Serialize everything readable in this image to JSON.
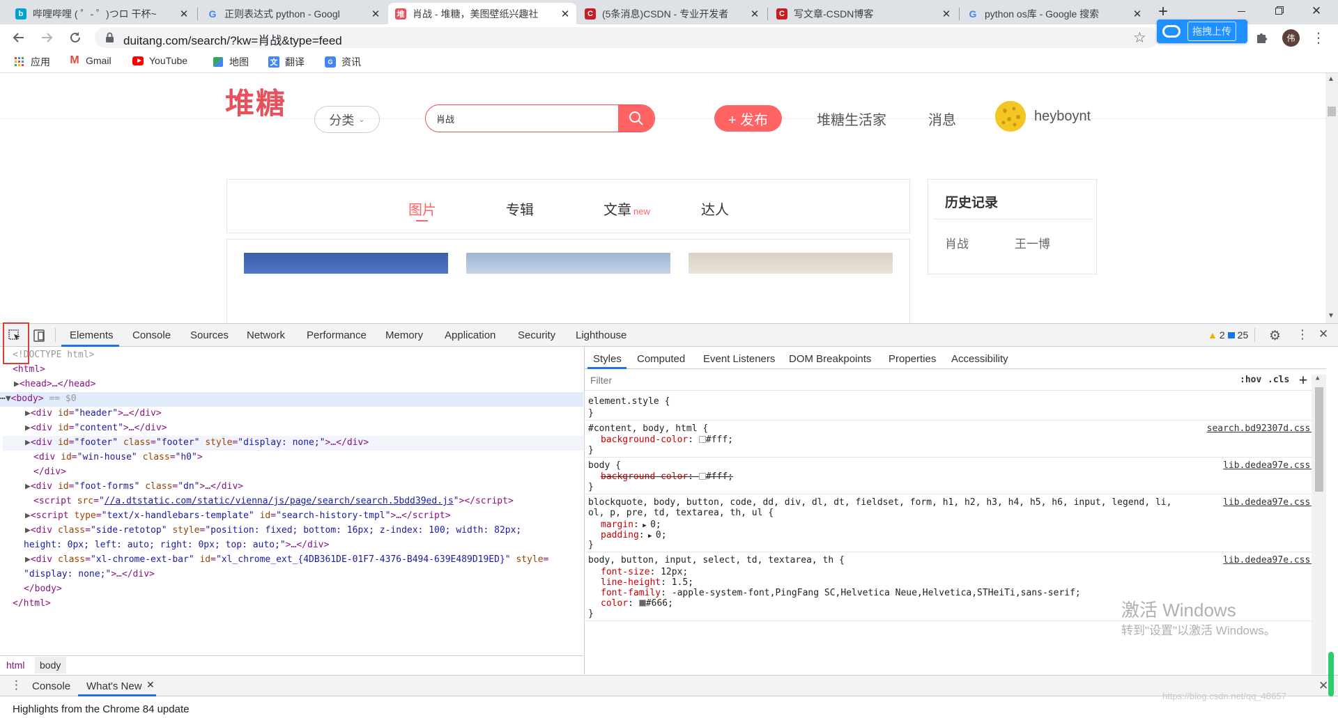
{
  "tabs": [
    {
      "title": "哔哩哔哩 ( ゜- ゜)つロ 干杯~",
      "favicon": "bilibili-icon",
      "color": "#00a1d6"
    },
    {
      "title": "正则表达式 python - Googl",
      "favicon": "google-icon",
      "color": "#4285f4"
    },
    {
      "title": "肖战 - 堆糖，美图壁纸兴趣社",
      "favicon": "duitang-icon",
      "color": "#e8505b",
      "active": true
    },
    {
      "title": "(5条消息)CSDN - 专业开发者",
      "favicon": "csdn-icon",
      "color": "#c71d23"
    },
    {
      "title": "写文章-CSDN博客",
      "favicon": "csdn-icon",
      "color": "#c71d23"
    },
    {
      "title": "python os库 - Google 搜索",
      "favicon": "google-icon",
      "color": "#4285f4"
    }
  ],
  "tab_close": "✕",
  "new_tab": "+",
  "address": {
    "url": "duitang.com/search/?kw=肖战&type=feed"
  },
  "extension_badge": "拖拽上传",
  "profile_initial": "伟",
  "bookmarks": [
    {
      "label": "应用",
      "icon": "apps-grid-icon"
    },
    {
      "label": "Gmail",
      "icon": "gmail-icon"
    },
    {
      "label": "YouTube",
      "icon": "youtube-icon"
    },
    {
      "label": "地图",
      "icon": "maps-icon"
    },
    {
      "label": "翻译",
      "icon": "translate-icon"
    },
    {
      "label": "资讯",
      "icon": "news-icon"
    }
  ],
  "site": {
    "logo": "堆糖",
    "category": "分类",
    "search_value": "肖战",
    "publish": "+ 发布",
    "nav": [
      "堆糖生活家",
      "消息"
    ],
    "username": "heyboynt",
    "content_tabs": [
      "图片",
      "专辑",
      "文章",
      "达人"
    ],
    "new_badge": "new",
    "history_title": "历史记录",
    "history_items": [
      "肖战",
      "王一博"
    ],
    "accent": "#ff6363"
  },
  "devtools": {
    "tabs": [
      "Elements",
      "Console",
      "Sources",
      "Network",
      "Performance",
      "Memory",
      "Application",
      "Security",
      "Lighthouse"
    ],
    "warnings": "2",
    "messages": "25",
    "dom": {
      "doctype": "<!DOCTYPE html>",
      "html_open": "<html>",
      "head": "<head>…</head>",
      "body_open": "<body>",
      "body_selected": " == $0",
      "header_id": "header",
      "content_id": "content",
      "footer_id": "footer",
      "footer_class": "footer",
      "footer_style": "display: none;",
      "winhouse_id": "win-house",
      "winhouse_class": "h0",
      "footforms_id": "foot-forms",
      "footforms_class": "dn",
      "script_src": "//a.dtstatic.com/static/vienna/js/page/search/search.5bdd39ed.js",
      "tmpl_type": "text/x-handlebars-template",
      "tmpl_id": "search-history-tmpl",
      "retotop_class": "side-retotop",
      "retotop_style_1": "position: fixed; bottom: 16px; z-index: 100; width: 82px;",
      "retotop_style_2": "height: 0px; left: auto; right: 0px; top: auto;",
      "chrome_class": "xl-chrome-ext-bar",
      "chrome_id": "xl_chrome_ext_{4DB361DE-01F7-4376-B494-639E489D19ED}",
      "chrome_style": "display: none;",
      "body_close": "</body>",
      "html_close": "</html>"
    },
    "style_tabs": [
      "Styles",
      "Computed",
      "Event Listeners",
      "DOM Breakpoints",
      "Properties",
      "Accessibility"
    ],
    "filter_placeholder": "Filter",
    "hov": ":hov",
    "cls": ".cls",
    "rules": {
      "element_style": "element.style {",
      "r1_selector": "#content, body, html {",
      "r1_source": "search.bd92307d.css:1",
      "r1_prop": "background-color",
      "r1_value": "#fff;",
      "r2_selector": "body {",
      "r2_source": "lib.dedea97e.css:1",
      "r2_prop": "background-color",
      "r2_value": "#fff;",
      "r3_selector_1": "blockquote, body, button, code, dd, div, dl, dt, fieldset, form, h1, h2, h3, h4, h5, h6, input, legend, li,",
      "r3_selector_2": "ol, p, pre, td, textarea, th, ul {",
      "r3_source": "lib.dedea97e.css:1",
      "r3_margin": "margin",
      "r3_margin_val": "0;",
      "r3_padding": "padding",
      "r3_padding_val": "0;",
      "r4_selector": "body, button, input, select, td, textarea, th {",
      "r4_source": "lib.dedea97e.css:1",
      "r4_font_size": "font-size",
      "r4_font_size_val": "12px;",
      "r4_line_height": "line-height",
      "r4_line_height_val": "1.5;",
      "r4_font_family": "font-family",
      "r4_font_family_val": "-apple-system-font,PingFang SC,Helvetica Neue,Helvetica,STHeiTi,sans-serif;",
      "r4_color": "color",
      "r4_color_val": "#666;",
      "close_brace": "}"
    },
    "breadcrumbs": [
      "html",
      "body"
    ],
    "drawer_tabs": [
      "Console",
      "What's New"
    ],
    "drawer_text": "Highlights from the Chrome 84 update"
  },
  "watermark": {
    "line1": "激活 Windows",
    "line2": "转到\"设置\"以激活 Windows。",
    "blog": "https://blog.csdn.net/qq_48657"
  }
}
